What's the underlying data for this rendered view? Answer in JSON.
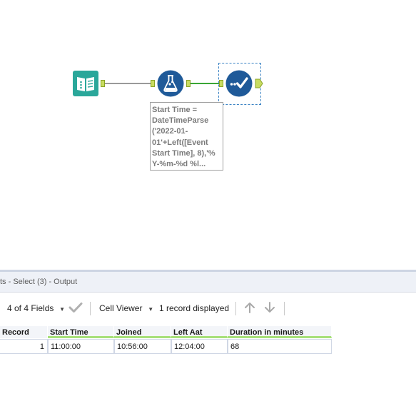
{
  "canvas": {
    "annotation": "Start Time =\nDateTimeParse\n('2022-01-\n01'+Left([Event\nStart Time], 8),'%\nY-%m-%d %l..."
  },
  "colors": {
    "input_tool": "#2aa79a",
    "formula_tool": "#1f5a99",
    "select_tool": "#1f5a99",
    "connection_selected": "#3aa635",
    "connection": "#9a9a9a",
    "anchor": "#c8dc60"
  },
  "icons": {
    "input": "book-icon",
    "formula": "flask-icon",
    "select": "checkmark-select-icon"
  },
  "results": {
    "title": "ts - Select (3) - Output",
    "toolbar": {
      "fields_label": "4 of 4 Fields",
      "cell_viewer_label": "Cell Viewer",
      "records_label": "1 record displayed"
    },
    "columns": [
      "Record",
      "Start Time",
      "Joined",
      "Left Aat",
      "Duration in minutes"
    ],
    "rows": [
      [
        "1",
        "11:00:00",
        "10:56:00",
        "12:04:00",
        "68"
      ]
    ]
  }
}
